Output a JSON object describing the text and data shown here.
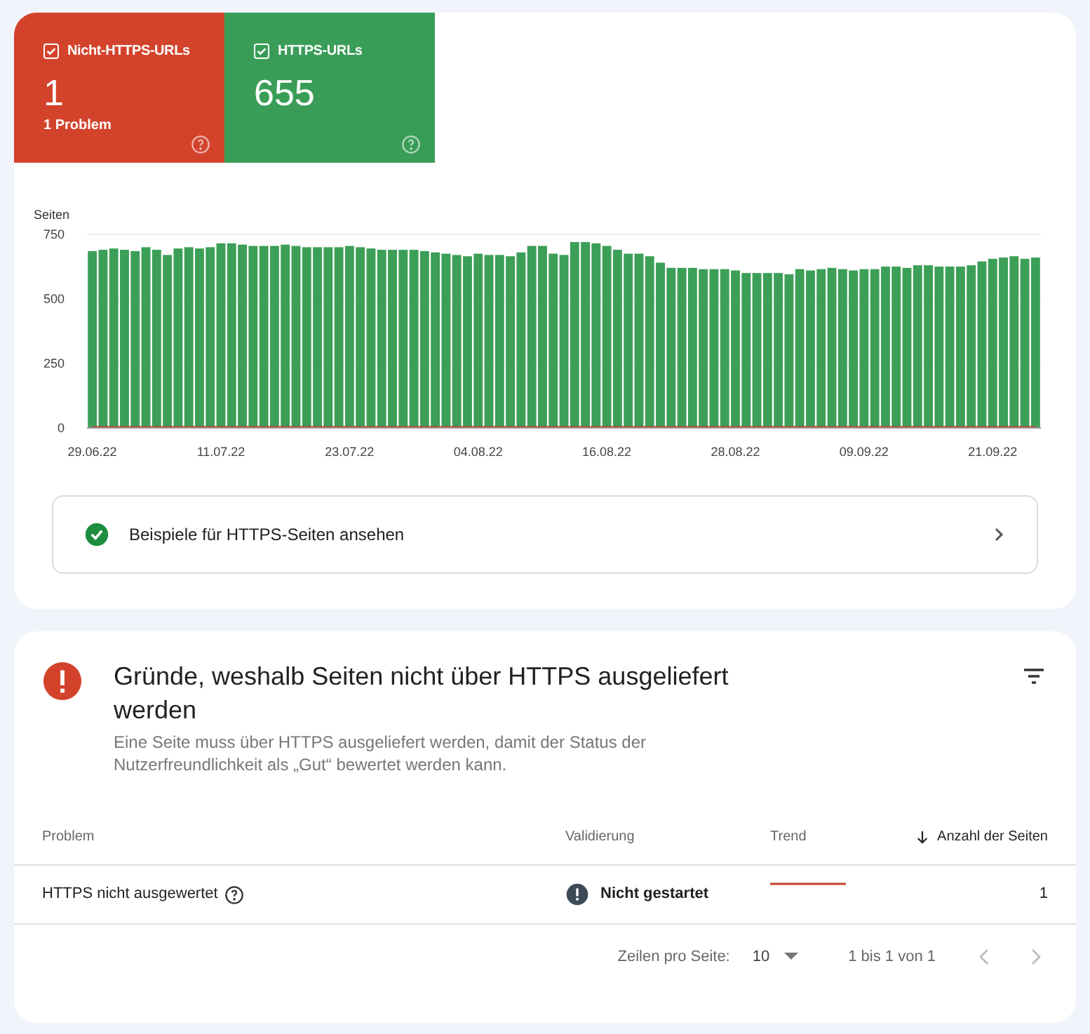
{
  "tiles": [
    {
      "kind": "error",
      "label": "Nicht-HTTPS-URLs",
      "checked": true,
      "value": "1",
      "subtitle": "1 Problem"
    },
    {
      "kind": "ok",
      "label": "HTTPS-URLs",
      "checked": true,
      "value": "655"
    }
  ],
  "chart": {
    "chart_data": {
      "type": "bar",
      "ylabel": "Seiten",
      "categories": [
        "29.06.22",
        null,
        null,
        null,
        null,
        null,
        null,
        null,
        null,
        null,
        null,
        null,
        "11.07.22",
        null,
        null,
        null,
        null,
        null,
        null,
        null,
        null,
        null,
        null,
        null,
        "23.07.22",
        null,
        null,
        null,
        null,
        null,
        null,
        null,
        null,
        null,
        null,
        null,
        "04.08.22",
        null,
        null,
        null,
        null,
        null,
        null,
        null,
        null,
        null,
        null,
        null,
        "16.08.22",
        null,
        null,
        null,
        null,
        null,
        null,
        null,
        null,
        null,
        null,
        null,
        "28.08.22",
        null,
        null,
        null,
        null,
        null,
        null,
        null,
        null,
        null,
        null,
        null,
        "09.09.22",
        null,
        null,
        null,
        null,
        null,
        null,
        null,
        null,
        null,
        null,
        null,
        "21.09.22",
        null,
        null,
        null,
        null
      ],
      "ylim": [
        0,
        750
      ],
      "yticks": [
        0,
        250,
        500,
        750
      ],
      "series": [
        {
          "color": "#3c9f57",
          "values": [
            685,
            690,
            695,
            690,
            685,
            700,
            690,
            670,
            695,
            700,
            695,
            700,
            715,
            715,
            710,
            705,
            705,
            705,
            710,
            705,
            700,
            700,
            700,
            700,
            705,
            700,
            695,
            690,
            690,
            690,
            690,
            685,
            680,
            675,
            670,
            665,
            675,
            670,
            670,
            665,
            680,
            705,
            705,
            675,
            670,
            720,
            720,
            715,
            705,
            690,
            675,
            675,
            665,
            640,
            620,
            620,
            620,
            615,
            615,
            615,
            610,
            600,
            600,
            600,
            600,
            595,
            615,
            610,
            615,
            620,
            615,
            610,
            615,
            615,
            625,
            625,
            620,
            630,
            630,
            625,
            625,
            625,
            630,
            645,
            655,
            660,
            665,
            655,
            660
          ]
        },
        {
          "type": "line",
          "color": "#c5412a",
          "values": [
            1,
            1,
            1,
            1,
            1,
            1,
            1,
            1,
            1,
            1,
            1,
            1,
            1,
            1,
            1,
            1,
            1,
            1,
            1,
            1,
            1,
            1,
            1,
            1,
            1,
            1,
            1,
            1,
            1,
            1,
            1,
            1,
            1,
            1,
            1,
            1,
            1,
            1,
            1,
            1,
            1,
            1,
            1,
            1,
            1,
            1,
            1,
            1,
            1,
            1,
            1,
            1,
            1,
            1,
            1,
            1,
            1,
            1,
            1,
            1,
            1,
            1,
            1,
            1,
            1,
            1,
            1,
            1,
            1,
            1,
            1,
            1,
            1,
            1,
            1,
            1,
            1,
            1,
            1,
            1,
            1,
            1,
            1,
            1,
            1,
            1,
            1,
            1,
            1
          ]
        }
      ]
    }
  },
  "examples_link": {
    "label": "Beispiele für HTTPS-Seiten ansehen"
  },
  "reasons": {
    "title": "Gründe, weshalb Seiten nicht über HTTPS ausgeliefert werden",
    "description": "Eine Seite muss über HTTPS ausgeliefert werden, damit der Status der Nutzerfreundlichkeit als „Gut“ bewertet werden kann.",
    "columns": [
      "Problem",
      "Validierung",
      "Trend",
      "Anzahl der Seiten"
    ],
    "rows": [
      {
        "problem": "HTTPS nicht ausgewertet",
        "validation": "Nicht gestartet",
        "count": "1"
      }
    ],
    "pagination": {
      "rows_label": "Zeilen pro Seite:",
      "rows_value": "10",
      "range": "1 bis 1 von 1"
    }
  }
}
